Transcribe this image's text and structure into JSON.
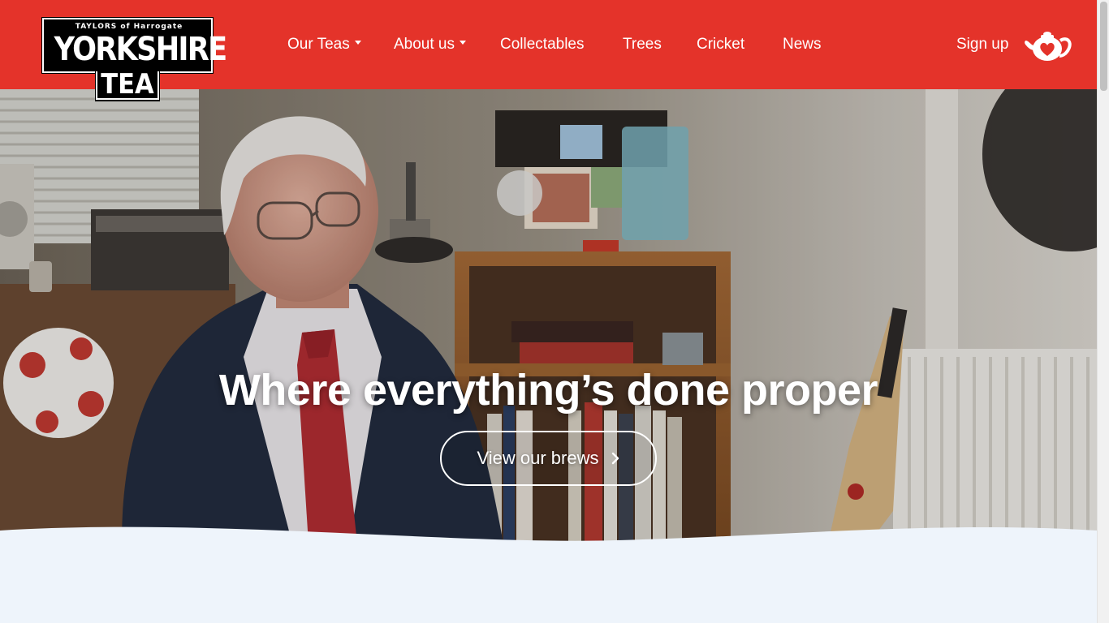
{
  "brand": {
    "top_line": "TAYLORS of Harrogate",
    "name_line1": "YORKSHIRE",
    "name_line2": "TEA",
    "header_color": "#e4332a"
  },
  "nav": {
    "items": [
      {
        "label": "Our Teas",
        "has_dropdown": true
      },
      {
        "label": "About us",
        "has_dropdown": true
      },
      {
        "label": "Collectables",
        "has_dropdown": false
      },
      {
        "label": "Trees",
        "has_dropdown": false
      },
      {
        "label": "Cricket",
        "has_dropdown": false
      },
      {
        "label": "News",
        "has_dropdown": false
      }
    ],
    "signup_label": "Sign up",
    "cart_icon": "teapot-heart-icon"
  },
  "hero": {
    "title": "Where everything’s done proper",
    "button_label": "View our brews",
    "button_icon": "chevron-right-icon"
  },
  "colors": {
    "accent": "#e4332a",
    "page_bg": "#eef4fb",
    "text_on_accent": "#ffffff"
  }
}
